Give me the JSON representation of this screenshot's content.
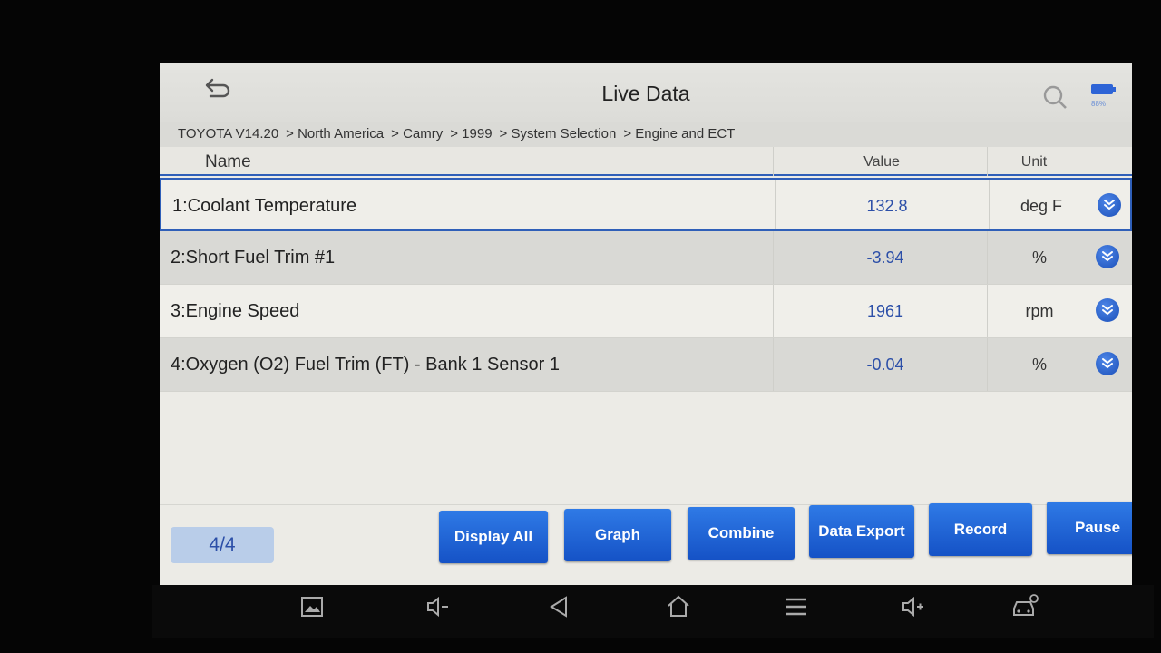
{
  "app": {
    "title": "Live Data",
    "battery_text": "88%"
  },
  "breadcrumb": [
    "TOYOTA  V14.20",
    "> North America",
    "> Camry",
    "> 1999",
    "> System Selection",
    "> Engine and ECT"
  ],
  "table": {
    "headers": {
      "name": "Name",
      "value": "Value",
      "unit": "Unit"
    },
    "rows": [
      {
        "name": "1:Coolant Temperature",
        "value": "132.8",
        "unit": "deg F"
      },
      {
        "name": "2:Short Fuel Trim #1",
        "value": "-3.94",
        "unit": "%"
      },
      {
        "name": "3:Engine Speed",
        "value": "1961",
        "unit": "rpm"
      },
      {
        "name": "4:Oxygen (O2) Fuel Trim (FT) - Bank 1 Sensor 1",
        "value": "-0.04",
        "unit": "%"
      }
    ]
  },
  "footer": {
    "page_current": "4",
    "page_separator": "/",
    "page_total": "4",
    "buttons": {
      "display_all": "Display All",
      "graph": "Graph",
      "combine": "Combine",
      "data_export": "Data Export",
      "record": "Record",
      "pause": "Pause"
    }
  },
  "icons": {
    "back": "back-arrow-icon",
    "search": "search-icon",
    "battery": "battery-icon",
    "expand": "chevron-double-down-icon",
    "nav": [
      "screenshot-icon",
      "volume-down-icon",
      "back-triangle-icon",
      "home-icon",
      "menu-icon",
      "volume-up-icon",
      "car-diagnostic-icon"
    ]
  },
  "colors": {
    "accent": "#1f5fd2",
    "value_text": "#2c4fa8",
    "header_line": "#2f5fb8"
  }
}
